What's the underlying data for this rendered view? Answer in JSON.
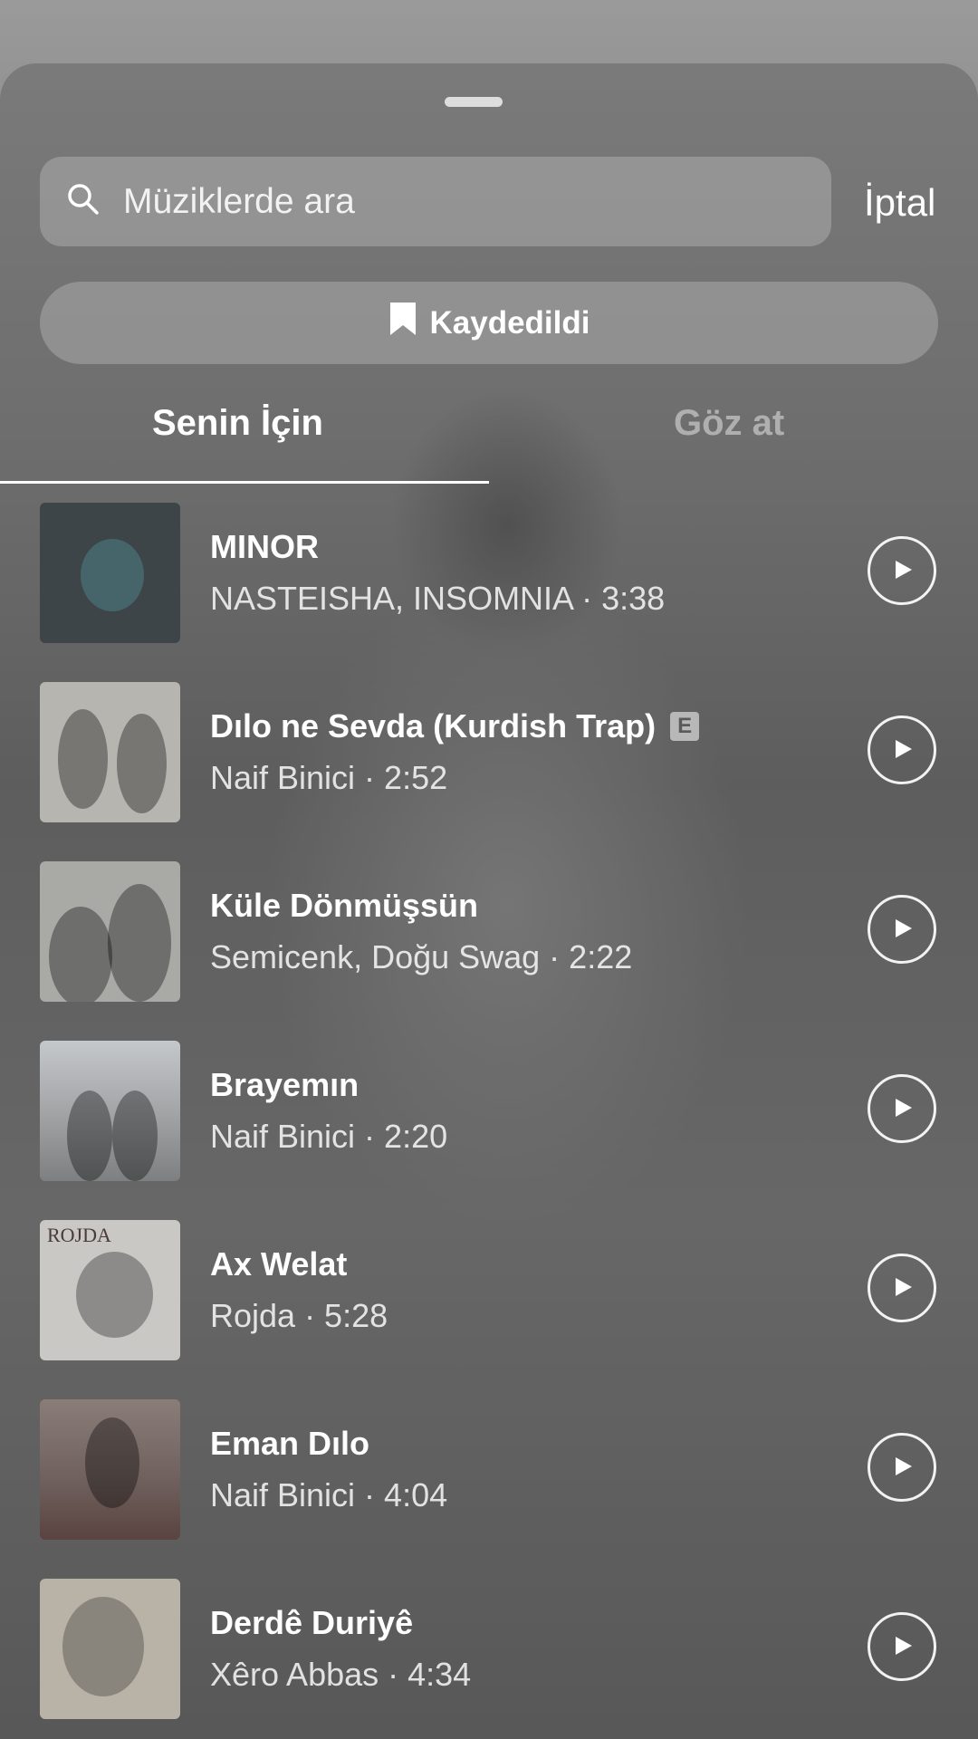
{
  "search": {
    "placeholder": "Müziklerde ara",
    "cancel_label": "İptal"
  },
  "saved_button": {
    "label": "Kaydedildi",
    "icon": "bookmark-icon"
  },
  "tabs": [
    {
      "label": "Senin İçin",
      "active": true
    },
    {
      "label": "Göz at",
      "active": false
    }
  ],
  "tracks": [
    {
      "title": "MINOR",
      "meta": "NASTEISHA, INSOMNIA · 3:38",
      "explicit": false,
      "art_color": "#3d4548"
    },
    {
      "title": "Dılo ne Sevda (Kurdish Trap)",
      "meta": "Naif Binici · 2:52",
      "explicit": true,
      "explicit_label": "E",
      "art_color": "#b7b5b0"
    },
    {
      "title": "Küle Dönmüşsün",
      "meta": "Semicenk, Doğu Swag · 2:22",
      "explicit": false,
      "art_color": "#a9a9a6"
    },
    {
      "title": "Brayemın",
      "meta": "Naif Binici · 2:20",
      "explicit": false,
      "art_color": "#a3a5a7"
    },
    {
      "title": "Ax Welat",
      "meta": "Rojda · 5:28",
      "explicit": false,
      "art_color": "#c9c8c4",
      "art_text": "ROJDA"
    },
    {
      "title": "Eman Dılo",
      "meta": "Naif Binici · 4:04",
      "explicit": false,
      "art_color": "#6e5f5c"
    },
    {
      "title": "Derdê Duriyê",
      "meta": "Xêro Abbas · 4:34",
      "explicit": false,
      "art_color": "#b9b2a6"
    }
  ]
}
